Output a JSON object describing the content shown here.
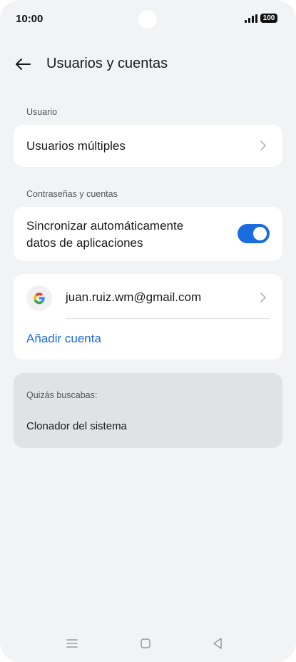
{
  "status_bar": {
    "time": "10:00",
    "battery": "100"
  },
  "header": {
    "title": "Usuarios y cuentas",
    "back_icon": "arrow-left-icon"
  },
  "sections": {
    "user_label": "Usuario",
    "accounts_label": "Contraseñas y cuentas"
  },
  "users": {
    "multiple_users_label": "Usuarios múltiples"
  },
  "sync": {
    "line1": "Sincronizar automáticamente",
    "line2": "datos de aplicaciones",
    "enabled": true
  },
  "accounts": {
    "items": [
      {
        "email": "juan.ruiz.wm@gmail.com",
        "provider_icon": "google-icon"
      }
    ],
    "add_label": "Añadir cuenta"
  },
  "suggestions": {
    "label": "Quizás buscabas:",
    "items": [
      "Clonador del sistema"
    ]
  },
  "colors": {
    "accent": "#1a6dde",
    "background": "#f2f3f5",
    "card": "#ffffff",
    "suggest_background": "#e1e2e5"
  }
}
